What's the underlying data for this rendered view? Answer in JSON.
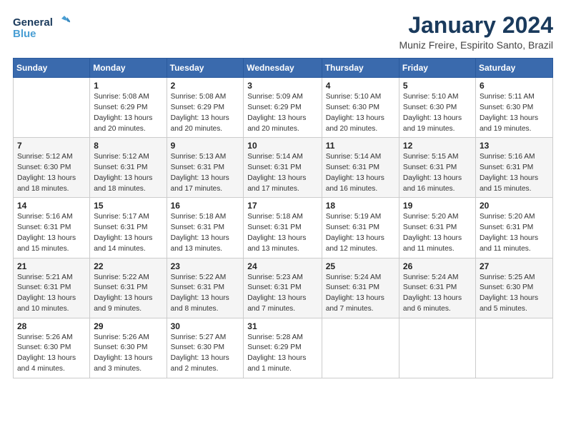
{
  "logo": {
    "line1": "General",
    "line2": "Blue"
  },
  "title": "January 2024",
  "location": "Muniz Freire, Espirito Santo, Brazil",
  "days_header": [
    "Sunday",
    "Monday",
    "Tuesday",
    "Wednesday",
    "Thursday",
    "Friday",
    "Saturday"
  ],
  "weeks": [
    [
      {
        "day": "",
        "info": ""
      },
      {
        "day": "1",
        "info": "Sunrise: 5:08 AM\nSunset: 6:29 PM\nDaylight: 13 hours\nand 20 minutes."
      },
      {
        "day": "2",
        "info": "Sunrise: 5:08 AM\nSunset: 6:29 PM\nDaylight: 13 hours\nand 20 minutes."
      },
      {
        "day": "3",
        "info": "Sunrise: 5:09 AM\nSunset: 6:29 PM\nDaylight: 13 hours\nand 20 minutes."
      },
      {
        "day": "4",
        "info": "Sunrise: 5:10 AM\nSunset: 6:30 PM\nDaylight: 13 hours\nand 20 minutes."
      },
      {
        "day": "5",
        "info": "Sunrise: 5:10 AM\nSunset: 6:30 PM\nDaylight: 13 hours\nand 19 minutes."
      },
      {
        "day": "6",
        "info": "Sunrise: 5:11 AM\nSunset: 6:30 PM\nDaylight: 13 hours\nand 19 minutes."
      }
    ],
    [
      {
        "day": "7",
        "info": "Sunrise: 5:12 AM\nSunset: 6:30 PM\nDaylight: 13 hours\nand 18 minutes."
      },
      {
        "day": "8",
        "info": "Sunrise: 5:12 AM\nSunset: 6:31 PM\nDaylight: 13 hours\nand 18 minutes."
      },
      {
        "day": "9",
        "info": "Sunrise: 5:13 AM\nSunset: 6:31 PM\nDaylight: 13 hours\nand 17 minutes."
      },
      {
        "day": "10",
        "info": "Sunrise: 5:14 AM\nSunset: 6:31 PM\nDaylight: 13 hours\nand 17 minutes."
      },
      {
        "day": "11",
        "info": "Sunrise: 5:14 AM\nSunset: 6:31 PM\nDaylight: 13 hours\nand 16 minutes."
      },
      {
        "day": "12",
        "info": "Sunrise: 5:15 AM\nSunset: 6:31 PM\nDaylight: 13 hours\nand 16 minutes."
      },
      {
        "day": "13",
        "info": "Sunrise: 5:16 AM\nSunset: 6:31 PM\nDaylight: 13 hours\nand 15 minutes."
      }
    ],
    [
      {
        "day": "14",
        "info": "Sunrise: 5:16 AM\nSunset: 6:31 PM\nDaylight: 13 hours\nand 15 minutes."
      },
      {
        "day": "15",
        "info": "Sunrise: 5:17 AM\nSunset: 6:31 PM\nDaylight: 13 hours\nand 14 minutes."
      },
      {
        "day": "16",
        "info": "Sunrise: 5:18 AM\nSunset: 6:31 PM\nDaylight: 13 hours\nand 13 minutes."
      },
      {
        "day": "17",
        "info": "Sunrise: 5:18 AM\nSunset: 6:31 PM\nDaylight: 13 hours\nand 13 minutes."
      },
      {
        "day": "18",
        "info": "Sunrise: 5:19 AM\nSunset: 6:31 PM\nDaylight: 13 hours\nand 12 minutes."
      },
      {
        "day": "19",
        "info": "Sunrise: 5:20 AM\nSunset: 6:31 PM\nDaylight: 13 hours\nand 11 minutes."
      },
      {
        "day": "20",
        "info": "Sunrise: 5:20 AM\nSunset: 6:31 PM\nDaylight: 13 hours\nand 11 minutes."
      }
    ],
    [
      {
        "day": "21",
        "info": "Sunrise: 5:21 AM\nSunset: 6:31 PM\nDaylight: 13 hours\nand 10 minutes."
      },
      {
        "day": "22",
        "info": "Sunrise: 5:22 AM\nSunset: 6:31 PM\nDaylight: 13 hours\nand 9 minutes."
      },
      {
        "day": "23",
        "info": "Sunrise: 5:22 AM\nSunset: 6:31 PM\nDaylight: 13 hours\nand 8 minutes."
      },
      {
        "day": "24",
        "info": "Sunrise: 5:23 AM\nSunset: 6:31 PM\nDaylight: 13 hours\nand 7 minutes."
      },
      {
        "day": "25",
        "info": "Sunrise: 5:24 AM\nSunset: 6:31 PM\nDaylight: 13 hours\nand 7 minutes."
      },
      {
        "day": "26",
        "info": "Sunrise: 5:24 AM\nSunset: 6:31 PM\nDaylight: 13 hours\nand 6 minutes."
      },
      {
        "day": "27",
        "info": "Sunrise: 5:25 AM\nSunset: 6:30 PM\nDaylight: 13 hours\nand 5 minutes."
      }
    ],
    [
      {
        "day": "28",
        "info": "Sunrise: 5:26 AM\nSunset: 6:30 PM\nDaylight: 13 hours\nand 4 minutes."
      },
      {
        "day": "29",
        "info": "Sunrise: 5:26 AM\nSunset: 6:30 PM\nDaylight: 13 hours\nand 3 minutes."
      },
      {
        "day": "30",
        "info": "Sunrise: 5:27 AM\nSunset: 6:30 PM\nDaylight: 13 hours\nand 2 minutes."
      },
      {
        "day": "31",
        "info": "Sunrise: 5:28 AM\nSunset: 6:29 PM\nDaylight: 13 hours\nand 1 minute."
      },
      {
        "day": "",
        "info": ""
      },
      {
        "day": "",
        "info": ""
      },
      {
        "day": "",
        "info": ""
      }
    ]
  ]
}
